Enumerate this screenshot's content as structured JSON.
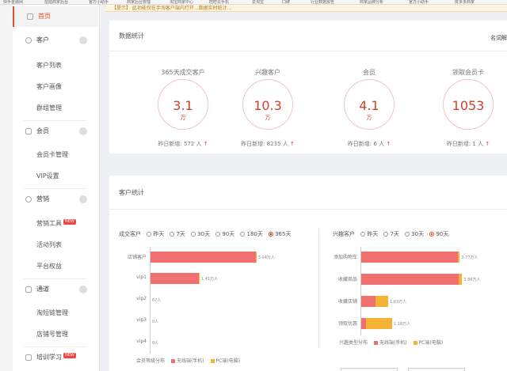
{
  "bookmarks": [
    "快手金融网",
    "拍拍商家后台",
    "官方小助手",
    "商家后台管理",
    "淘宝商家中心",
    "旺旺云手机",
    "爱淘宝",
    "口碑",
    "行业数据报告",
    "商家品牌分析",
    "官方小助手",
    "拼多多商家"
  ],
  "notice": "【提示】 此功能仅在手淘客户端内打开...数据实时统计...",
  "sidebar": {
    "home": "首页",
    "customer": "客户",
    "customer_list": "客户列表",
    "customer_portrait": "客户画像",
    "group_mgmt": "群组管理",
    "member": "会员",
    "member_card": "会员卡管理",
    "vip": "VIP设置",
    "marketing": "营销",
    "marketing_tools": "营销工具",
    "marketing_tools_badge": "NEW",
    "activity_list": "活动列表",
    "platform_rights": "平台权益",
    "channel": "通道",
    "taozhanggui": "淘短链管理",
    "shop_account": "店铺号管理",
    "training": "培训学习",
    "training_badge": "NEW"
  },
  "stats_panel": {
    "title": "数据统计",
    "right_label": "名词解",
    "items": [
      {
        "label": "365天成交客户",
        "value": "3.1",
        "unit": "万",
        "yesterday": "昨日新增: 572 人"
      },
      {
        "label": "兴趣客户",
        "value": "10.3",
        "unit": "万",
        "yesterday": "昨日新增: 8235 人"
      },
      {
        "label": "会员",
        "value": "4.1",
        "unit": "万",
        "yesterday": "昨日新增: 6 人"
      },
      {
        "label": "领取会员卡",
        "value": "1053",
        "unit": "",
        "yesterday": "昨日新增: 1 人"
      }
    ]
  },
  "customer_panel": {
    "title": "客户统计",
    "left_filter": {
      "label": "成交客户",
      "options": [
        "昨天",
        "7天",
        "30天",
        "90天",
        "180天",
        "365天"
      ],
      "selected": "365天"
    },
    "right_filter": {
      "label": "兴趣客户",
      "options": [
        "昨天",
        "7天",
        "30天",
        "90天"
      ],
      "selected": "90天"
    },
    "left_bars": [
      {
        "label": "店铺客户",
        "value_text": "3.04万人",
        "values": [
          3.02,
          0.02
        ]
      },
      {
        "label": "vip1",
        "value_text": "1.41万人",
        "values": [
          1.38,
          0.03
        ]
      },
      {
        "label": "vip2",
        "value_text": "67人",
        "values": [
          0,
          0
        ]
      },
      {
        "label": "vip3",
        "value_text": "0人",
        "values": [
          0,
          0
        ]
      },
      {
        "label": "vip4",
        "value_text": "0人",
        "values": [
          0,
          0
        ]
      }
    ],
    "right_bars": [
      {
        "label": "添加购物车",
        "value_text": "3.77万人",
        "values": [
          3.7,
          0.07
        ]
      },
      {
        "label": "收藏商品",
        "value_text": "3.86万人",
        "values": [
          3.72,
          0.14
        ]
      },
      {
        "label": "收藏店铺",
        "value_text": "1.03万人",
        "values": [
          0.55,
          0.48
        ]
      },
      {
        "label": "领取优惠",
        "value_text": "1.18万人",
        "values": [
          0.18,
          1.0
        ]
      }
    ],
    "left_legend": {
      "label": "会员等级分布",
      "series": [
        "无线端(手机)",
        "PC端(电脑)"
      ]
    },
    "right_legend": {
      "label": "兴趣类型分布",
      "series": [
        "无线端(手机)",
        "PC端(电脑)"
      ]
    },
    "colors": {
      "mobile": "#f07070",
      "pc": "#f5b335"
    }
  }
}
